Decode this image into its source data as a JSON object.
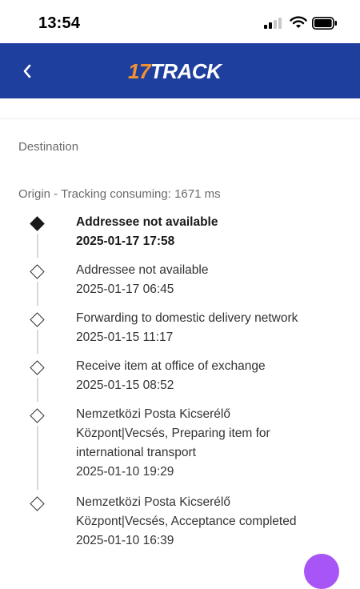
{
  "status_bar": {
    "time": "13:54",
    "icons": [
      "signal-icon",
      "wifi-icon",
      "battery-icon"
    ]
  },
  "header": {
    "logo_number": "17",
    "logo_text": "TRACK",
    "back_icon": "chevron-left-icon",
    "colors": {
      "background": "#1f3f9f",
      "logo_accent": "#f2922f"
    }
  },
  "sections": {
    "destination": "Destination",
    "origin": "Origin - Tracking consuming: 1671 ms"
  },
  "events": [
    {
      "title": "Addressee not available",
      "time": "2025-01-17 17:58",
      "current": true
    },
    {
      "title": "Addressee not available",
      "time": "2025-01-17 06:45",
      "current": false
    },
    {
      "title": "Forwarding to domestic delivery network",
      "time": "2025-01-15 11:17",
      "current": false
    },
    {
      "title": "Receive item at office of exchange",
      "time": "2025-01-15 08:52",
      "current": false
    },
    {
      "title": "Nemzetközi Posta Kicserélő Központ|Vecsés, Preparing item for international transport",
      "time": "2025-01-10 19:29",
      "current": false
    },
    {
      "title": "Nemzetközi Posta Kicserélő Központ|Vecsés, Acceptance completed",
      "time": "2025-01-10 16:39",
      "current": false
    }
  ]
}
